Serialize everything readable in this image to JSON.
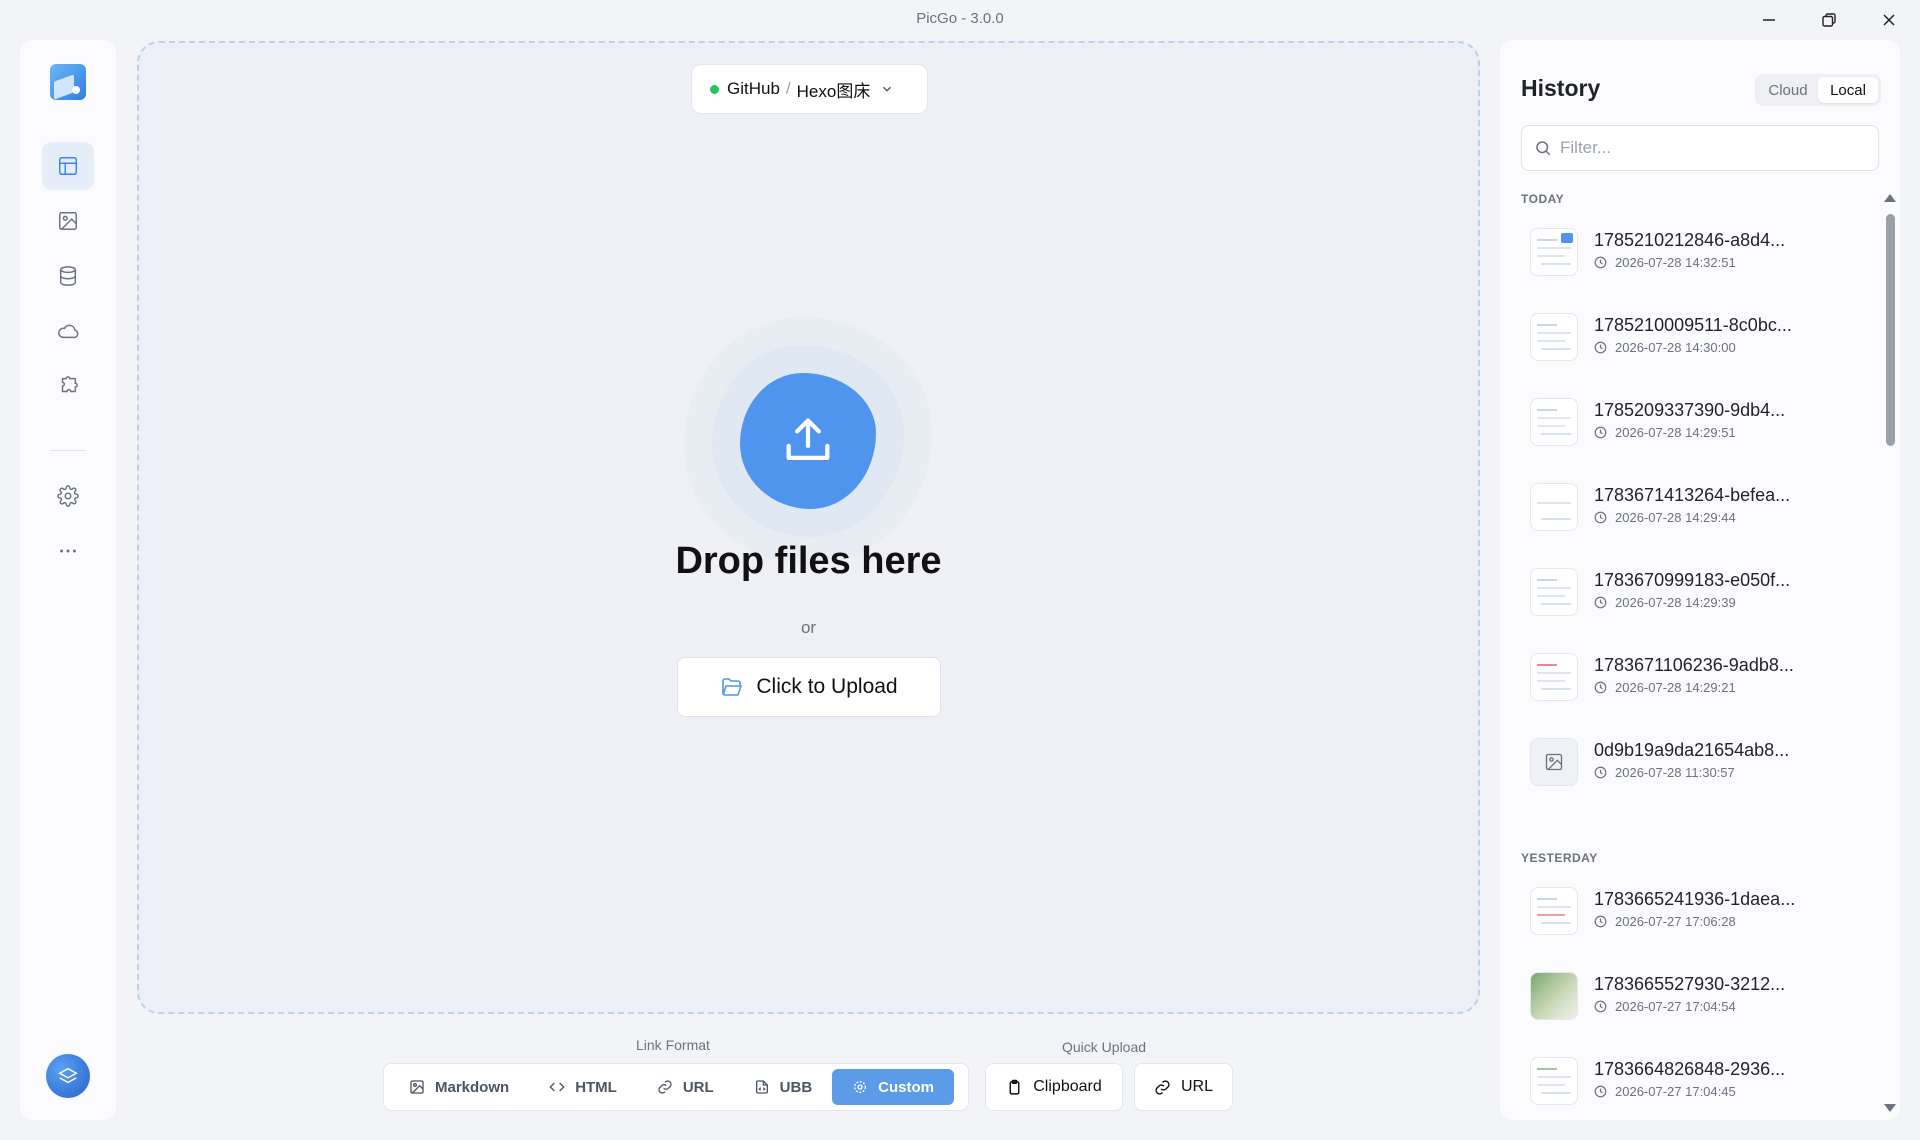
{
  "window": {
    "title": "PicGo - 3.0.0"
  },
  "picker": {
    "provider": "GitHub",
    "separator": "/",
    "config": "Hexo图床"
  },
  "drop": {
    "title": "Drop files here",
    "or": "or",
    "upload_label": "Click to Upload"
  },
  "link_format": {
    "label": "Link Format",
    "options": [
      {
        "label": "Markdown",
        "icon": "image-icon"
      },
      {
        "label": "HTML",
        "icon": "code-icon"
      },
      {
        "label": "URL",
        "icon": "link-icon"
      },
      {
        "label": "UBB",
        "icon": "file-code-icon"
      },
      {
        "label": "Custom",
        "icon": "gear-icon"
      }
    ],
    "selected": "Custom"
  },
  "quick_upload": {
    "label": "Quick Upload",
    "buttons": [
      {
        "label": "Clipboard",
        "icon": "clipboard-icon"
      },
      {
        "label": "URL",
        "icon": "link-icon"
      }
    ]
  },
  "history": {
    "title": "History",
    "tabs": [
      "Cloud",
      "Local"
    ],
    "active_tab": "Local",
    "filter_placeholder": "Filter...",
    "sections": [
      {
        "label": "TODAY",
        "items": [
          {
            "name": "1785210212846-a8d4...",
            "time": "2026-07-28 14:32:51"
          },
          {
            "name": "1785210009511-8c0bc...",
            "time": "2026-07-28 14:30:00"
          },
          {
            "name": "1785209337390-9db4...",
            "time": "2026-07-28 14:29:51"
          },
          {
            "name": "1783671413264-befea...",
            "time": "2026-07-28 14:29:44"
          },
          {
            "name": "1783670999183-e050f...",
            "time": "2026-07-28 14:29:39"
          },
          {
            "name": "1783671106236-9adb8...",
            "time": "2026-07-28 14:29:21"
          },
          {
            "name": "0d9b19a9da21654ab8...",
            "time": "2026-07-28 11:30:57"
          }
        ]
      },
      {
        "label": "YESTERDAY",
        "items": [
          {
            "name": "1783665241936-1daea...",
            "time": "2026-07-27 17:06:28"
          },
          {
            "name": "1783665527930-3212...",
            "time": "2026-07-27 17:04:54"
          },
          {
            "name": "1783664826848-2936...",
            "time": "2026-07-27 17:04:45"
          }
        ]
      }
    ]
  },
  "colors": {
    "accent": "#4f95ee",
    "status_online": "#22c55e",
    "active_format": "#5b9be8"
  }
}
